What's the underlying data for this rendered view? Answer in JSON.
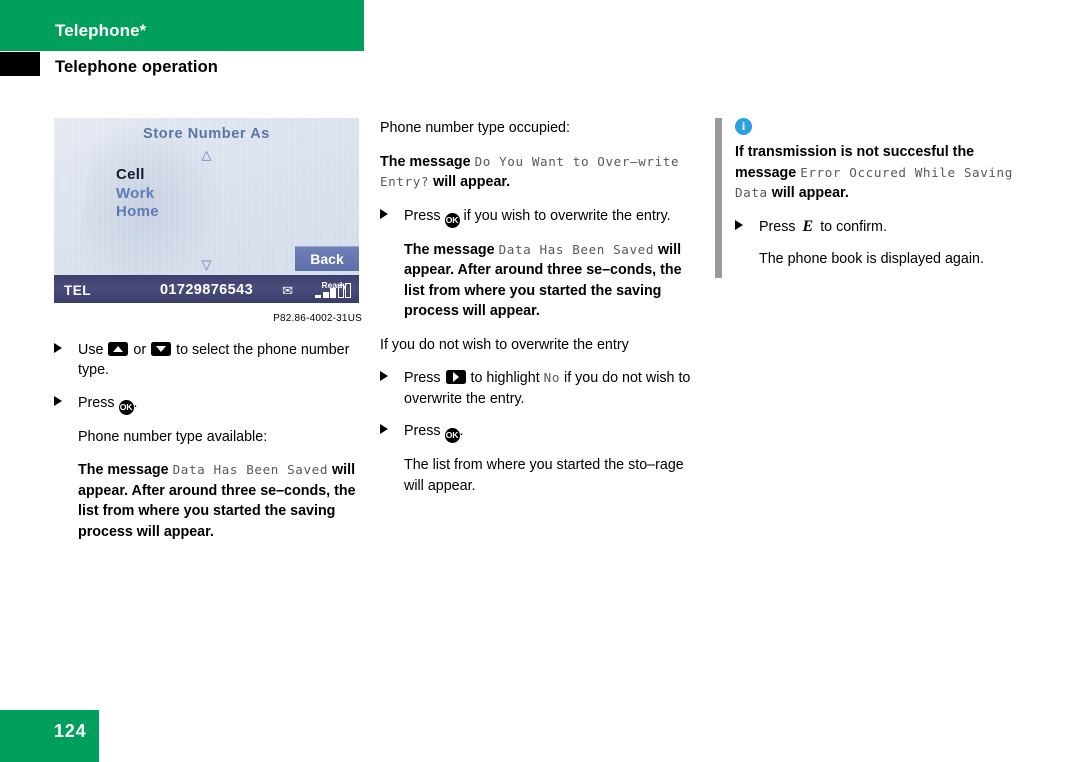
{
  "header": {
    "title": "Telephone*",
    "subtitle": "Telephone operation",
    "green": "#00a05c"
  },
  "device": {
    "title": "Store Number As",
    "up_arrow": "△",
    "down_arrow": "▽",
    "items": [
      {
        "label": "Cell",
        "selected": true
      },
      {
        "label": "Work",
        "selected": false
      },
      {
        "label": "Home",
        "selected": false
      }
    ],
    "back_label": "Back",
    "status": {
      "mode": "TEL",
      "number": "01729876543",
      "mail_icon": "✉",
      "ready_label": "Ready"
    },
    "caption": "P82.86-4002-31US"
  },
  "left_column": {
    "step1": {
      "pre": "Use",
      "mid": "or",
      "post": "to select the phone number type."
    },
    "step2": {
      "pre": "Press",
      "post": "."
    },
    "available_label": "Phone number type available:",
    "saved_msg": {
      "pre": "The message",
      "mono": "Data Has Been Saved",
      "post": "will appear. After around three se–conds, the list from where you started the saving process will appear."
    }
  },
  "mid_column": {
    "occupied_label": "Phone number type occupied:",
    "overwrite_msg": {
      "pre": "The message",
      "mono": "Do You Want to Over–write Entry?",
      "post": "will appear."
    },
    "step_overwrite": {
      "pre": "Press",
      "post": "if you wish to overwrite the entry."
    },
    "saved_msg": {
      "pre": "The message",
      "mono": "Data Has Been Saved",
      "post": "will appear. After around three se–conds, the list from where you started the saving process will appear."
    },
    "no_overwrite_label": "If you do not wish to overwrite the entry",
    "step_no": {
      "pre": "Press",
      "mid": "to highlight",
      "mono": "No",
      "post": "if you do not wish to overwrite the entry."
    },
    "step_ok": {
      "pre": "Press",
      "post": "."
    },
    "result": "The list from where you started the sto–rage will appear."
  },
  "right_column": {
    "info_glyph": "i",
    "note_msg": {
      "pre": "If transmission is not succesful the message",
      "mono": "Error Occured While Saving Data",
      "post": "will appear."
    },
    "step_confirm": {
      "pre": "Press",
      "key": "E",
      "post": "to confirm."
    },
    "result": "The phone book is displayed again."
  },
  "footer": {
    "page": "124"
  }
}
